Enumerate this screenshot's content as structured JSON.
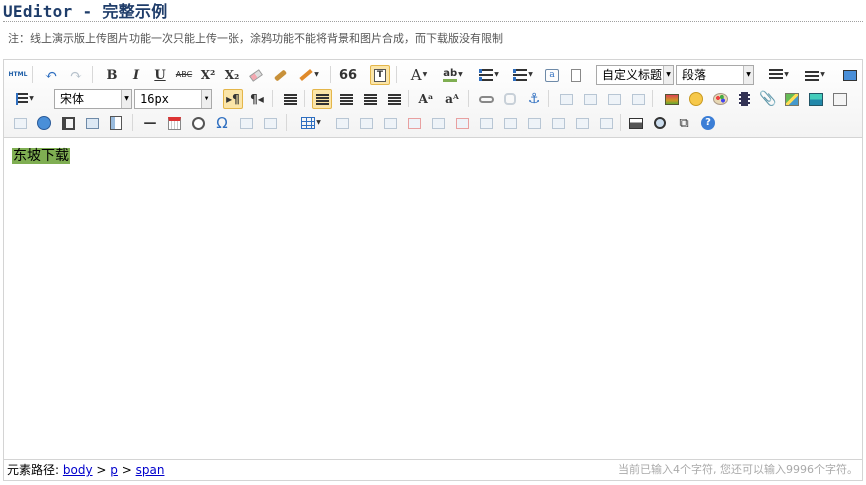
{
  "page": {
    "title": "UEditor - 完整示例",
    "note": "注：线上演示版上传图片功能一次只能上传一张，涂鸦功能不能将背景和图片合成，而下载版没有限制"
  },
  "toolbar": {
    "html_label": "HTML",
    "bold": "B",
    "italic": "I",
    "underline": "U",
    "strike": "ABC",
    "superscript": "X²",
    "subscript": "X₂",
    "quote": "66",
    "font_color": "A",
    "highlight": "ab",
    "custom_heading": "自定义标题",
    "paragraph": "段落",
    "font_family": "宋体",
    "font_size": "16px",
    "omega": "Ω"
  },
  "content": {
    "text": "东坡下载"
  },
  "statusbar": {
    "path_label": "元素路径:",
    "path": [
      "body",
      "p",
      "span"
    ],
    "sep": ">",
    "count_text": "当前已输入4个字符, 您还可以输入9996个字符。"
  }
}
